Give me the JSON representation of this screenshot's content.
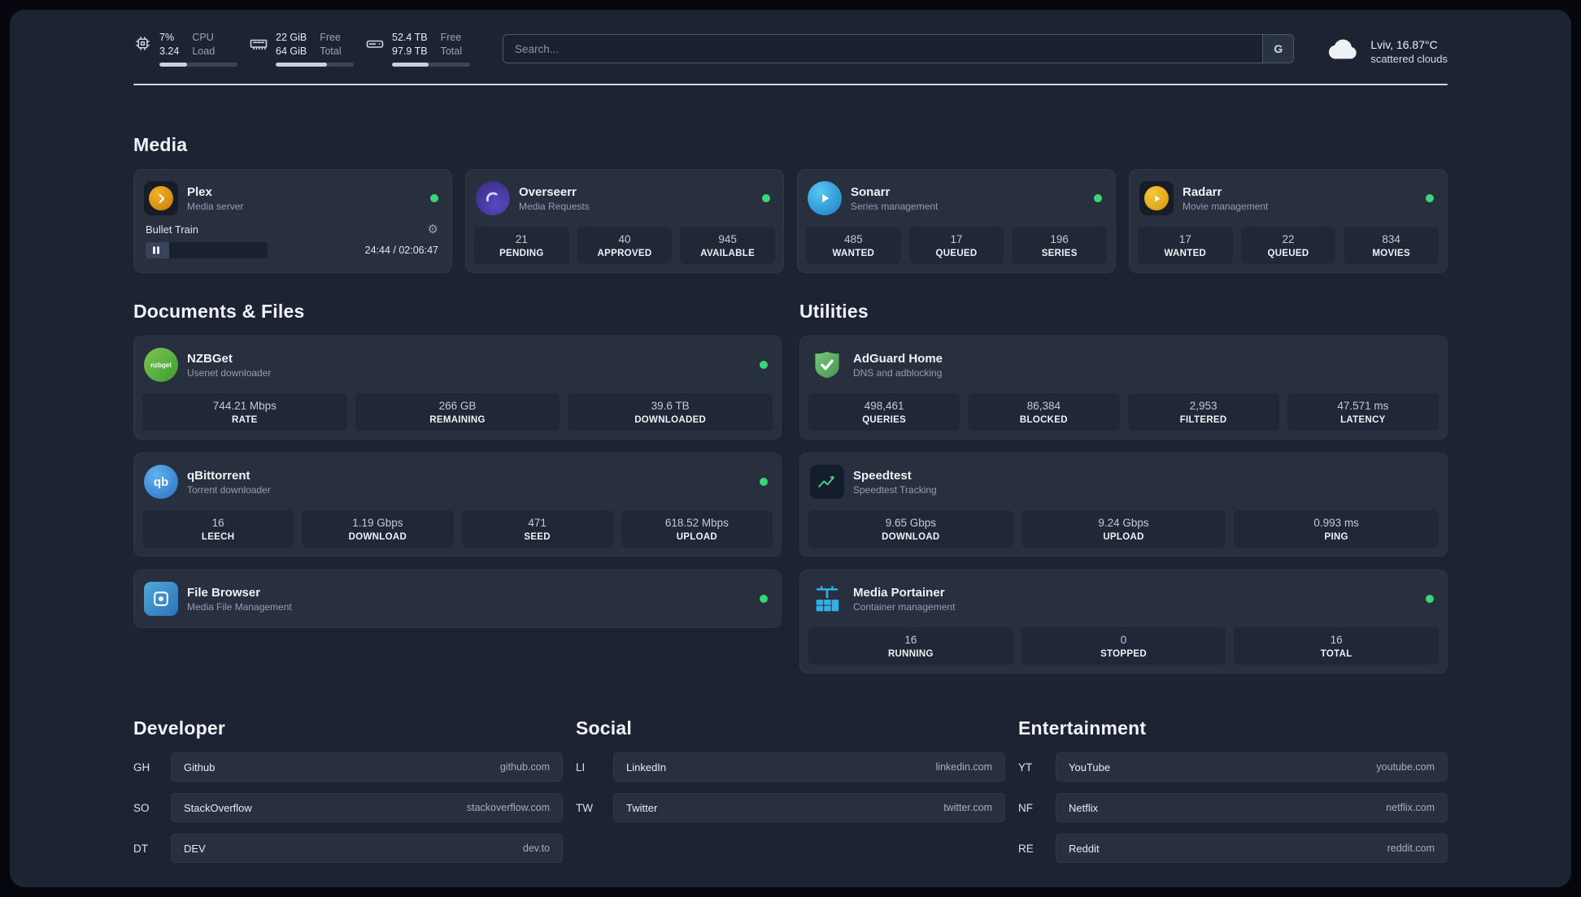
{
  "topbar": {
    "cpu": {
      "percent": "7%",
      "load": "3.24",
      "label_line1": "CPU",
      "label_line2": "Load",
      "progress": 35
    },
    "memory": {
      "free": "22 GiB",
      "total": "64 GiB",
      "free_label": "Free",
      "total_label": "Total",
      "progress": 66
    },
    "disk": {
      "free": "52.4 TB",
      "total": "97.9 TB",
      "free_label": "Free",
      "total_label": "Total",
      "progress": 47
    },
    "search": {
      "placeholder": "Search...",
      "engine_label": "G"
    },
    "weather": {
      "location": "Lviv, 16.87°C",
      "condition": "scattered clouds"
    }
  },
  "colors": {
    "status_online": "#3bd676",
    "accent_green": "#49d17c"
  },
  "sections": {
    "media": {
      "title": "Media",
      "cards": [
        {
          "title": "Plex",
          "subtitle": "Media server",
          "player": {
            "track": "Bullet Train",
            "time": "24:44 / 02:06:47",
            "progress": 19
          }
        },
        {
          "title": "Overseerr",
          "subtitle": "Media Requests",
          "stats": [
            {
              "value": "21",
              "label": "PENDING"
            },
            {
              "value": "40",
              "label": "APPROVED"
            },
            {
              "value": "945",
              "label": "AVAILABLE"
            }
          ]
        },
        {
          "title": "Sonarr",
          "subtitle": "Series management",
          "stats": [
            {
              "value": "485",
              "label": "WANTED"
            },
            {
              "value": "17",
              "label": "QUEUED"
            },
            {
              "value": "196",
              "label": "SERIES"
            }
          ]
        },
        {
          "title": "Radarr",
          "subtitle": "Movie management",
          "stats": [
            {
              "value": "17",
              "label": "WANTED"
            },
            {
              "value": "22",
              "label": "QUEUED"
            },
            {
              "value": "834",
              "label": "MOVIES"
            }
          ]
        }
      ]
    },
    "documents": {
      "title": "Documents & Files",
      "cards": [
        {
          "title": "NZBGet",
          "subtitle": "Usenet downloader",
          "stats": [
            {
              "value": "744.21 Mbps",
              "label": "RATE"
            },
            {
              "value": "266 GB",
              "label": "REMAINING"
            },
            {
              "value": "39.6 TB",
              "label": "DOWNLOADED"
            }
          ]
        },
        {
          "title": "qBittorrent",
          "subtitle": "Torrent downloader",
          "stats": [
            {
              "value": "16",
              "label": "LEECH"
            },
            {
              "value": "1.19 Gbps",
              "label": "DOWNLOAD"
            },
            {
              "value": "471",
              "label": "SEED"
            },
            {
              "value": "618.52 Mbps",
              "label": "UPLOAD"
            }
          ]
        },
        {
          "title": "File Browser",
          "subtitle": "Media File Management"
        }
      ]
    },
    "utilities": {
      "title": "Utilities",
      "cards": [
        {
          "title": "AdGuard Home",
          "subtitle": "DNS and adblocking",
          "stats": [
            {
              "value": "498,461",
              "label": "QUERIES"
            },
            {
              "value": "86,384",
              "label": "BLOCKED"
            },
            {
              "value": "2,953",
              "label": "FILTERED"
            },
            {
              "value": "47.571 ms",
              "label": "LATENCY"
            }
          ]
        },
        {
          "title": "Speedtest",
          "subtitle": "Speedtest Tracking",
          "stats": [
            {
              "value": "9.65 Gbps",
              "label": "DOWNLOAD"
            },
            {
              "value": "9.24 Gbps",
              "label": "UPLOAD"
            },
            {
              "value": "0.993 ms",
              "label": "PING"
            }
          ]
        },
        {
          "title": "Media Portainer",
          "subtitle": "Container management",
          "stats": [
            {
              "value": "16",
              "label": "RUNNING"
            },
            {
              "value": "0",
              "label": "STOPPED"
            },
            {
              "value": "16",
              "label": "TOTAL"
            }
          ]
        }
      ]
    }
  },
  "bookmarks": [
    {
      "title": "Developer",
      "items": [
        {
          "abbr": "GH",
          "name": "Github",
          "url": "github.com"
        },
        {
          "abbr": "SO",
          "name": "StackOverflow",
          "url": "stackoverflow.com"
        },
        {
          "abbr": "DT",
          "name": "DEV",
          "url": "dev.to"
        }
      ]
    },
    {
      "title": "Social",
      "items": [
        {
          "abbr": "LI",
          "name": "LinkedIn",
          "url": "linkedin.com"
        },
        {
          "abbr": "TW",
          "name": "Twitter",
          "url": "twitter.com"
        }
      ]
    },
    {
      "title": "Entertainment",
      "items": [
        {
          "abbr": "YT",
          "name": "YouTube",
          "url": "youtube.com"
        },
        {
          "abbr": "NF",
          "name": "Netflix",
          "url": "netflix.com"
        },
        {
          "abbr": "RE",
          "name": "Reddit",
          "url": "reddit.com"
        }
      ]
    }
  ]
}
